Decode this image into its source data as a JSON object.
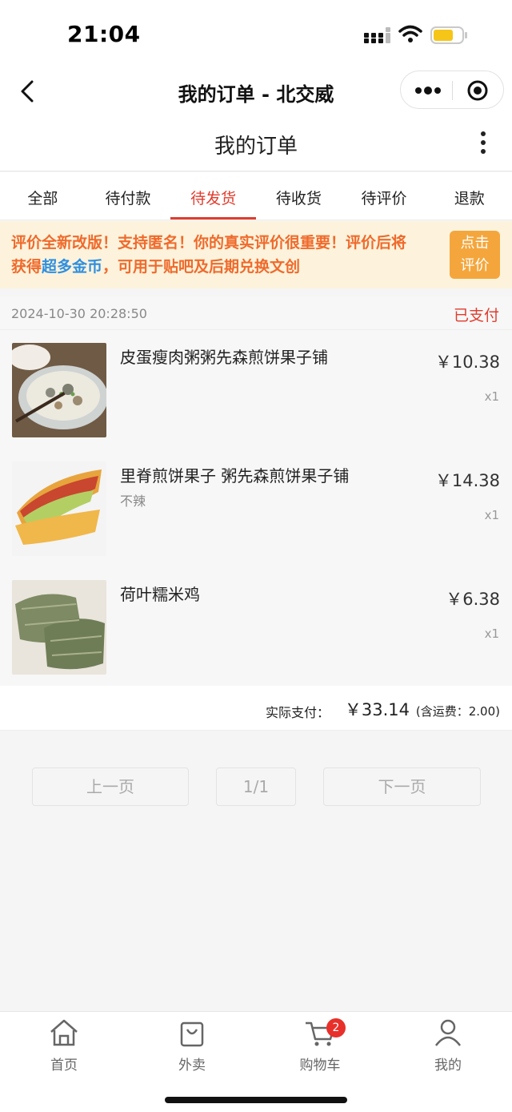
{
  "status_bar": {
    "time": "21:04",
    "battery_color": "#f5c518"
  },
  "nav": {
    "title": "我的订单 - 北交威",
    "back_icon": "chevron-left-icon",
    "menu_icon": "more-dots-icon",
    "close_icon": "target-icon"
  },
  "header": {
    "title": "我的订单",
    "more_icon": "vertical-dots-icon"
  },
  "tabs": [
    {
      "label": "全部",
      "active": false
    },
    {
      "label": "待付款",
      "active": false
    },
    {
      "label": "待发货",
      "active": true
    },
    {
      "label": "待收货",
      "active": false
    },
    {
      "label": "待评价",
      "active": false
    },
    {
      "label": "退款",
      "active": false
    }
  ],
  "notice": {
    "line1": "评价全新改版！支持匿名！你的真实评价很重要！评价后将",
    "line2_pre": "获得",
    "line2_highlight": "超多金币",
    "line2_post": "，可用于贴吧及后期兑换文创",
    "button_line1": "点击",
    "button_line2": "评价"
  },
  "order": {
    "date": "2024-10-30 20:28:50",
    "status": "已支付",
    "items": [
      {
        "name": "皮蛋瘦肉粥粥先森煎饼果子铺",
        "spec": "",
        "price": "￥10.38",
        "qty": "x1",
        "image": "congee-bowl-image"
      },
      {
        "name": "里脊煎饼果子 粥先森煎饼果子铺",
        "spec": "不辣",
        "price": "￥14.38",
        "qty": "x1",
        "image": "jianbing-wrap-image"
      },
      {
        "name": "荷叶糯米鸡",
        "spec": "",
        "price": "￥6.38",
        "qty": "x1",
        "image": "lotus-leaf-rice-image"
      }
    ],
    "total_label": "实际支付：",
    "total_price": "￥33.14",
    "shipping_note": "(含运费：2.00)"
  },
  "pager": {
    "prev": "上一页",
    "page": "1/1",
    "next": "下一页"
  },
  "tabbar": [
    {
      "label": "首页",
      "icon": "home-icon"
    },
    {
      "label": "外卖",
      "icon": "shopping-bag-icon"
    },
    {
      "label": "购物车",
      "icon": "cart-icon",
      "badge": "2"
    },
    {
      "label": "我的",
      "icon": "user-icon"
    }
  ],
  "colors": {
    "accent": "#e03c2e",
    "notice_bg": "#fdf3dc",
    "notice_text": "#ef6a2c",
    "notice_button": "#f4a63c",
    "highlight": "#2f8fe0"
  }
}
